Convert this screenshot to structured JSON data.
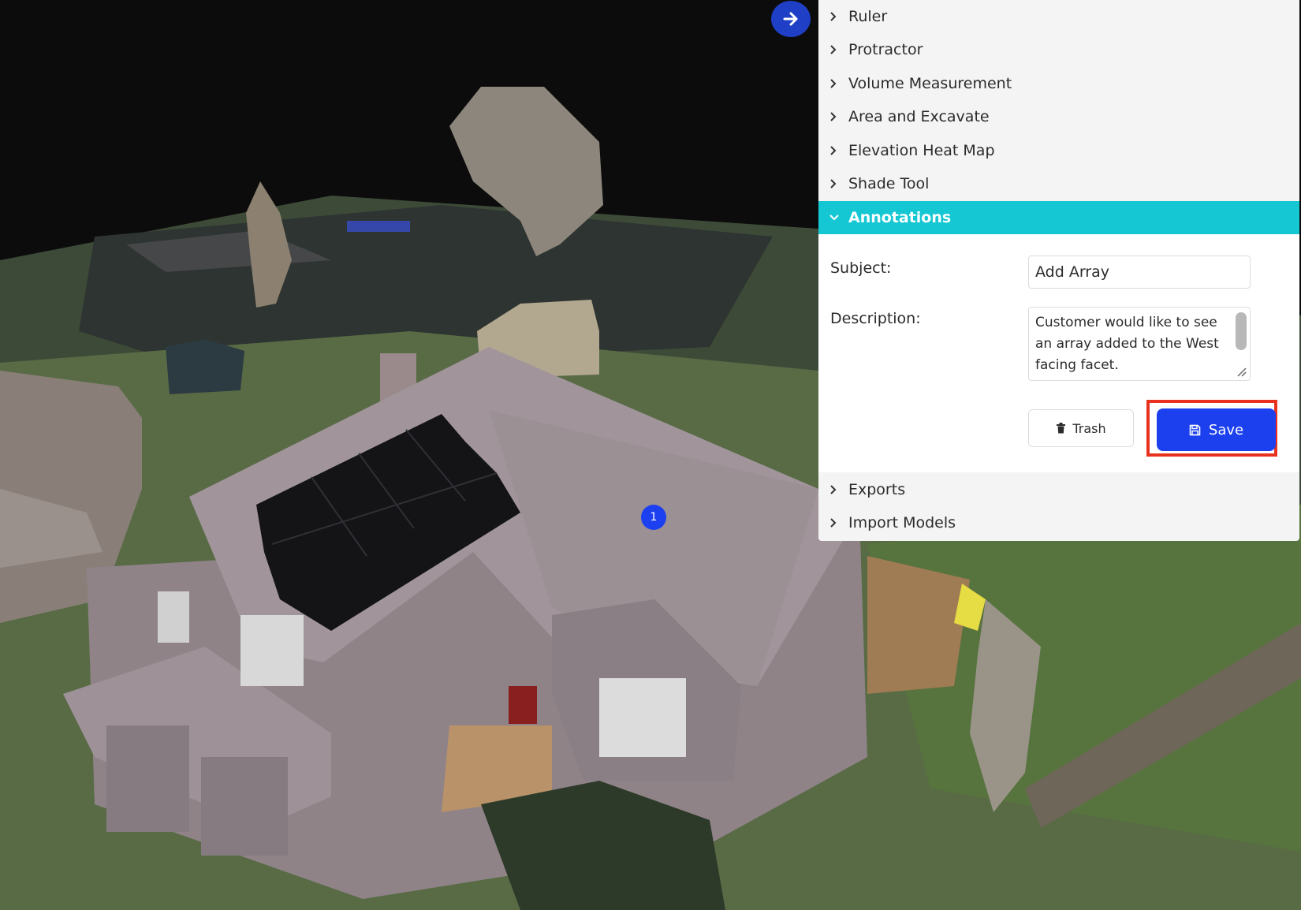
{
  "panel": {
    "collapse_icon": "arrow-right-icon",
    "tools": [
      {
        "label": "Ruler"
      },
      {
        "label": "Protractor"
      },
      {
        "label": "Volume Measurement"
      },
      {
        "label": "Area and Excavate"
      },
      {
        "label": "Elevation Heat Map"
      },
      {
        "label": "Shade Tool"
      }
    ],
    "annotations": {
      "label": "Annotations",
      "subject_label": "Subject:",
      "subject_value": "Add Array",
      "description_label": "Description:",
      "description_value": "Customer would like to see an array added to the West facing facet.",
      "trash_label": "Trash",
      "save_label": "Save"
    },
    "more_tools": [
      {
        "label": "Exports"
      },
      {
        "label": "Import Models"
      }
    ]
  },
  "scene": {
    "marker_label": "1"
  },
  "colors": {
    "active_header": "#14c7d3",
    "primary": "#1c40ee",
    "highlight_outline": "#e8321e",
    "panel_bg": "#f4f4f4"
  }
}
